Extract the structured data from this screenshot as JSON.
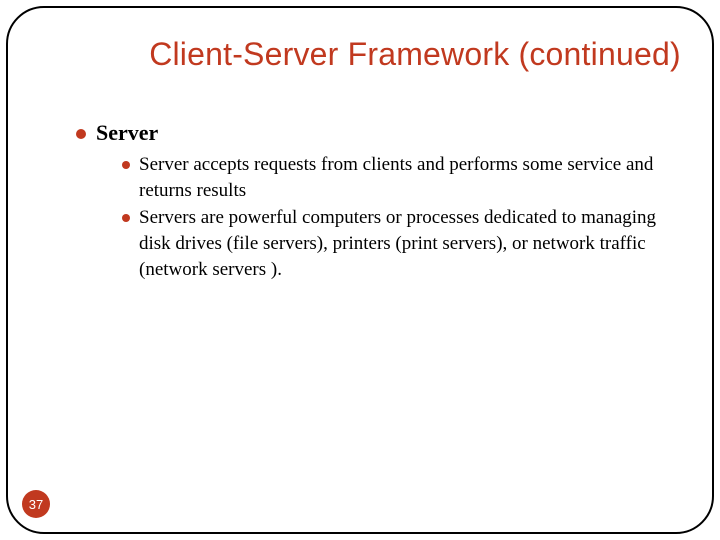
{
  "slide": {
    "title": "Client-Server Framework (continued)",
    "page_number": "37",
    "bullets": {
      "lvl1": {
        "label": "Server"
      },
      "lvl2": [
        {
          "text": "Server accepts requests from clients and performs some service and returns results"
        },
        {
          "text": "Servers are powerful computers or processes dedicated to managing disk drives (file servers), printers (print servers), or network traffic (network servers )."
        }
      ]
    }
  }
}
